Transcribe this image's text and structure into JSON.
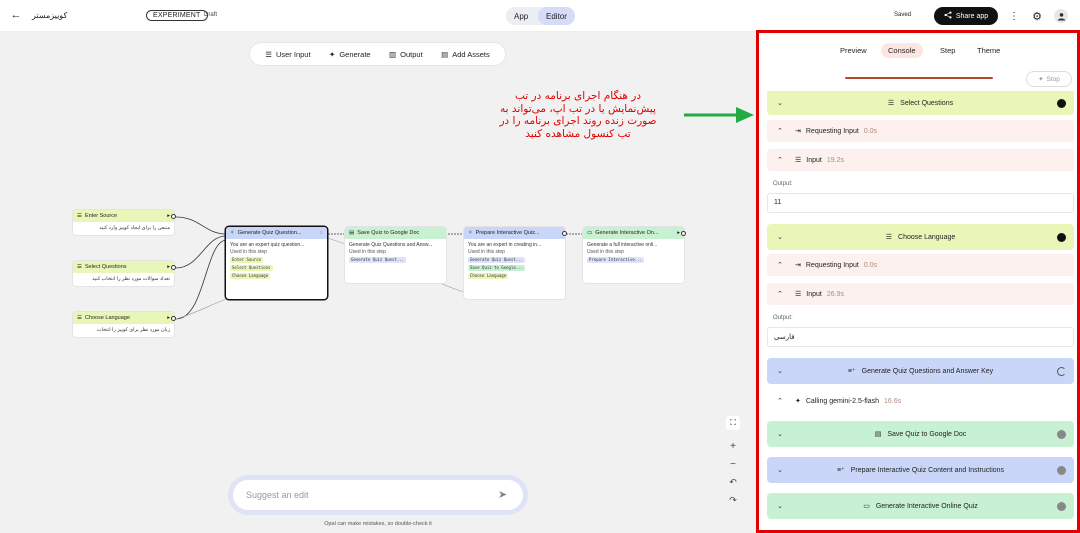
{
  "topbar": {
    "app_name": "کوییزمستر",
    "badge": "EXPERIMENT",
    "status": "Draft",
    "modes": [
      "App",
      "Editor"
    ],
    "saved": "Saved",
    "share": "Share app"
  },
  "toolbar": {
    "items": [
      "User Input",
      "Generate",
      "Output",
      "Add Assets"
    ]
  },
  "nodes": {
    "enter_source": {
      "title": "Enter Source",
      "desc": "منبعی را برای ایجاد کوییز وارد کنید"
    },
    "select_questions": {
      "title": "Select Questions",
      "desc": "تعداد سوالات مورد نظر را انتخاب کنید"
    },
    "choose_language": {
      "title": "Choose Language",
      "desc": "زبان مورد نظر برای کوییز را انتخاب"
    },
    "gen_quiz": {
      "title": "Generate Quiz Question...",
      "desc": "You are an expert quiz question...",
      "used": "Used in this step",
      "chips": [
        "Enter Source",
        "Select Questions",
        "Choose Language"
      ]
    },
    "save_doc": {
      "title": "Save Quiz to Google Doc",
      "desc": "Generate Quiz Questions and Answ...",
      "used": "Used in this step",
      "chips": [
        "Generate Quiz Quest..."
      ]
    },
    "prepare": {
      "title": "Prepare Interactive Quiz...",
      "desc": "You are an expert in creating in...",
      "used": "Used in this step",
      "chips": [
        "Generate Quiz Quest...",
        "Save Quiz to Google...",
        "Choose Language"
      ]
    },
    "gen_online": {
      "title": "Generate Interactive On...",
      "desc": "Generate a full interactive onli...",
      "used": "Used in this step",
      "chips": [
        "Prepare Interactive..."
      ]
    }
  },
  "annotation": {
    "lines": [
      "در هنگام اجرای برنامه در تب",
      "پیش‌نمایش یا در تب اپ، می‌تواند به",
      "صورت زنده روند اجرای برنامه را در",
      "تب کنسول مشاهده کنید"
    ]
  },
  "edit": {
    "placeholder": "Suggest an edit",
    "disclaimer": "Opal can make mistakes, so double-check it"
  },
  "panel": {
    "tabs": [
      "Preview",
      "Console",
      "Step",
      "Theme"
    ],
    "stop": "Stop",
    "steps": [
      {
        "label": "Select Questions"
      },
      {
        "label": "Requesting Input",
        "time": "0.0s"
      },
      {
        "label": "Input",
        "time": "19.2s"
      },
      {
        "output_label": "Output:",
        "output_value": "11"
      },
      {
        "label": "Choose Language"
      },
      {
        "label": "Requesting Input",
        "time": "0.0s"
      },
      {
        "label": "Input",
        "time": "26.9s"
      },
      {
        "output_label": "Output:",
        "output_value": "فارسی"
      },
      {
        "label": "Generate Quiz Questions and Answer Key"
      },
      {
        "label": "Calling gemini-2.5-flash",
        "time": "16.6s"
      },
      {
        "label": "Save Quiz to Google Doc"
      },
      {
        "label": "Prepare Interactive Quiz Content and Instructions"
      },
      {
        "label": "Generate Interactive Online Quiz"
      }
    ]
  },
  "colors": {
    "input": "#e8f7b8",
    "generate": "#c9d6f7",
    "output": "#c8f1d3",
    "highlight": "#e10000",
    "annotation": "#e10000",
    "arrow": "#22aa44"
  }
}
